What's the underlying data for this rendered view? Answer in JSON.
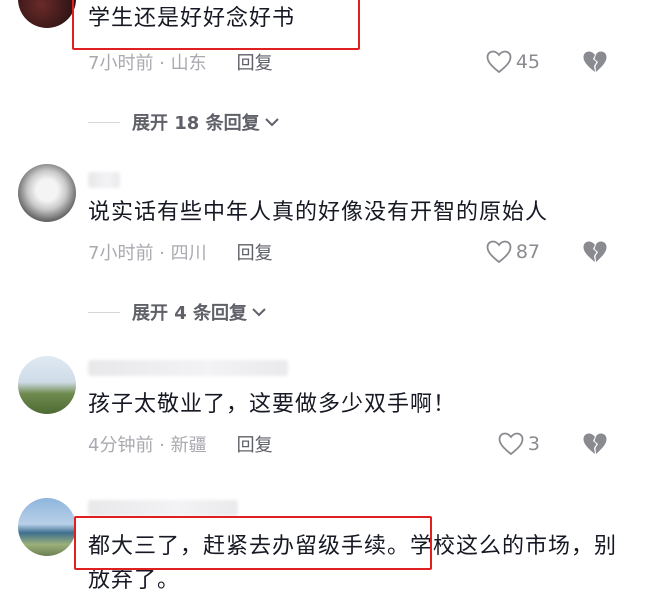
{
  "comments": [
    {
      "text": "学生还是好好念好书",
      "time_location": "7小时前 · 山东",
      "reply_label": "回复",
      "likes": "45",
      "expand_label": "展开 18 条回复"
    },
    {
      "text": "说实话有些中年人真的好像没有开智的原始人",
      "time_location": "7小时前 · 四川",
      "reply_label": "回复",
      "likes": "87",
      "expand_label": "展开 4 条回复"
    },
    {
      "text": "孩子太敬业了，这要做多少双手啊！",
      "time_location": "4分钟前 · 新疆",
      "reply_label": "回复",
      "likes": "3"
    },
    {
      "text": "都大三了，赶紧去办留级手续。学校这么的市场，别放弃了。"
    }
  ],
  "colors": {
    "highlight": "#e02020",
    "text": "#161823",
    "meta": "#a9aab0"
  }
}
